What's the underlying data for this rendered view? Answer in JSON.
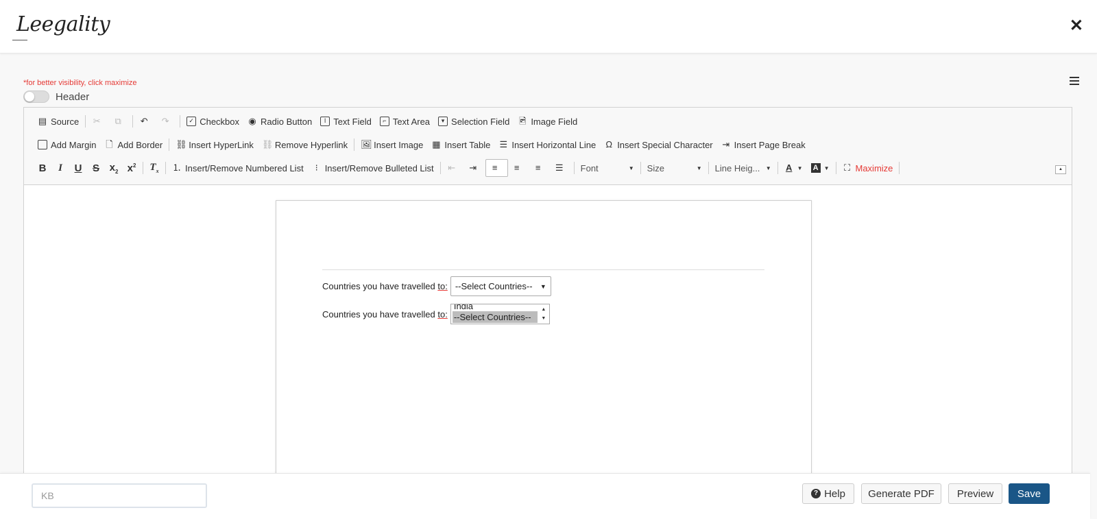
{
  "app": {
    "logo_text": "Leegality",
    "close_label": "✕"
  },
  "hint": "*for better visibility, click maximize",
  "header_toggle": {
    "label": "Header"
  },
  "toolbar": {
    "row1": {
      "source": "Source",
      "checkbox": "Checkbox",
      "radio": "Radio Button",
      "text_field": "Text Field",
      "text_area": "Text Area",
      "selection_field": "Selection Field",
      "image_field": "Image Field"
    },
    "row2": {
      "add_margin": "Add Margin",
      "add_border": "Add Border",
      "insert_hyperlink": "Insert HyperLink",
      "remove_hyperlink": "Remove Hyperlink",
      "insert_image": "Insert Image",
      "insert_table": "Insert Table",
      "insert_hline": "Insert Horizontal Line",
      "insert_special": "Insert Special Character",
      "insert_pagebreak": "Insert Page Break"
    },
    "row3": {
      "bold": "B",
      "italic": "I",
      "underline": "U",
      "strike": "S",
      "numbered_list": "Insert/Remove Numbered List",
      "bulleted_list": "Insert/Remove Bulleted List",
      "font": "Font",
      "size": "Size",
      "line_height": "Line Heig...",
      "maximize": "Maximize"
    }
  },
  "document": {
    "q1_label_pre": "Countries you have travelled ",
    "q1_label_mark": "to:",
    "q1_select_value": "--Select Countries--",
    "q2_label_pre": "Countries you have travelled ",
    "q2_label_mark": "to:",
    "q2_list_top": "India",
    "q2_list_selected": "--Select Countries--"
  },
  "footer": {
    "kb_placeholder": "KB",
    "help": "Help",
    "generate_pdf": "Generate PDF",
    "preview": "Preview",
    "save": "Save"
  }
}
